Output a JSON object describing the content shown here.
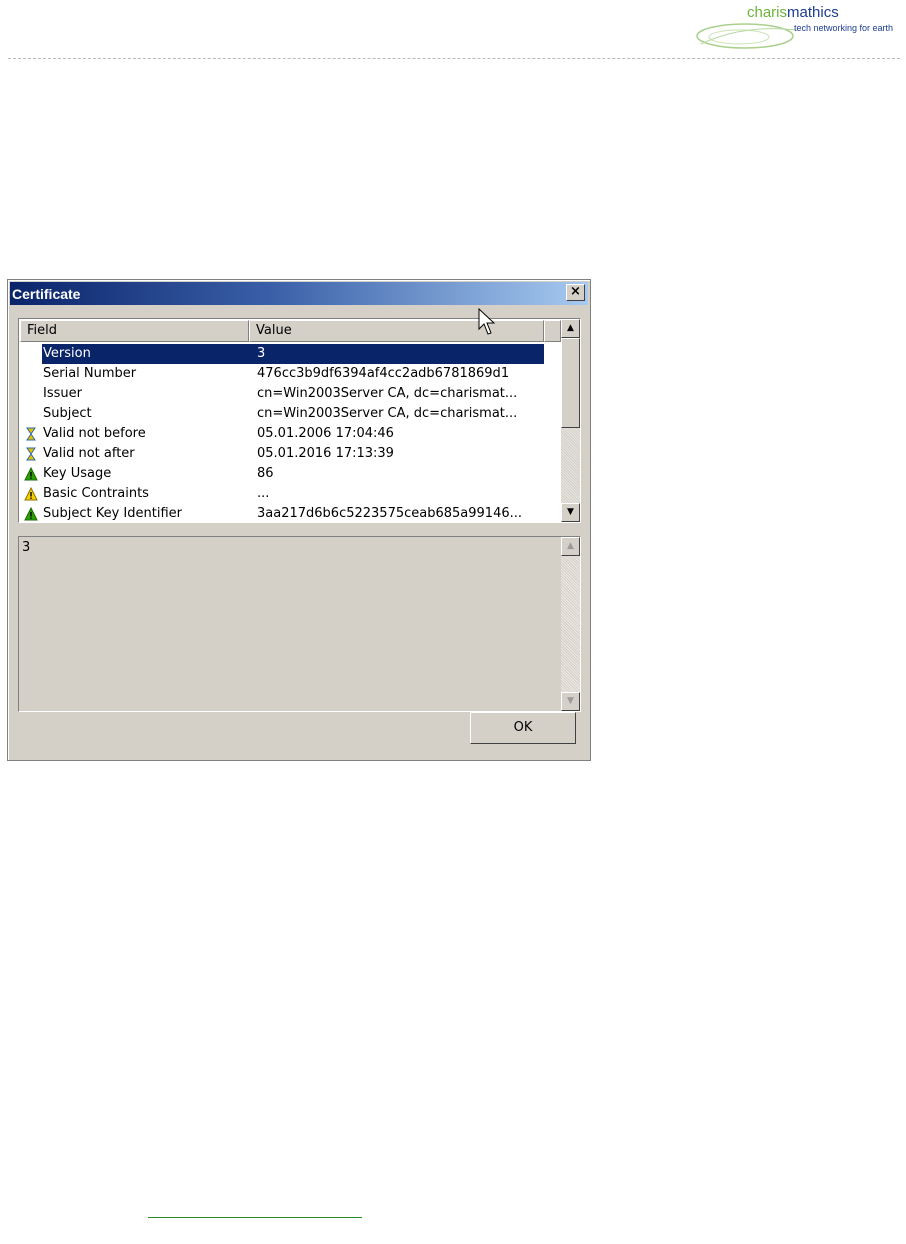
{
  "header": {
    "logo_name_part1": "charis",
    "logo_name_part2": "mathics",
    "logo_tagline": "tech networking for earth"
  },
  "dialog": {
    "title": "Certificate",
    "close_label": "×",
    "columns": {
      "field": "Field",
      "value": "Value"
    },
    "rows": [
      {
        "field": "Version",
        "value": "3",
        "icon": "none",
        "selected": true
      },
      {
        "field": "Serial Number",
        "value": "476cc3b9df6394af4cc2adb6781869d1",
        "icon": "none"
      },
      {
        "field": "Issuer",
        "value": "cn=Win2003Server CA, dc=charismat...",
        "icon": "none"
      },
      {
        "field": "Subject",
        "value": "cn=Win2003Server CA, dc=charismat...",
        "icon": "none"
      },
      {
        "field": "Valid not before",
        "value": "05.01.2006 17:04:46",
        "icon": "hourglass-icon"
      },
      {
        "field": "Valid not after",
        "value": "05.01.2016 17:13:39",
        "icon": "hourglass-icon"
      },
      {
        "field": "Key Usage",
        "value": "86",
        "icon": "warning-green-icon"
      },
      {
        "field": "Basic Contraints",
        "value": "...",
        "icon": "warning-yellow-icon"
      },
      {
        "field": "Subject Key Identifier",
        "value": "3aa217d6b6c5223575ceab685a99146...",
        "icon": "warning-green-icon"
      }
    ],
    "detail_text": "3",
    "ok_label": "OK"
  },
  "colors": {
    "title_start": "#0a246a",
    "title_end": "#a6caf0",
    "selection": "#0a246a",
    "dialog_face": "#d4d0c8",
    "logo_green": "#6db43a",
    "logo_blue": "#1d3d92"
  }
}
